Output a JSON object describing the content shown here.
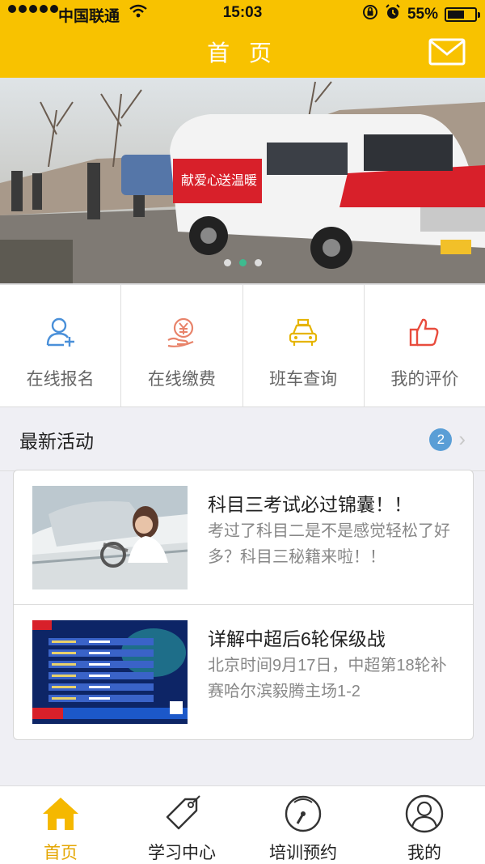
{
  "status": {
    "carrier": "中国联通",
    "time": "15:03",
    "battery": "55%"
  },
  "nav": {
    "title": "首 页"
  },
  "banner": {
    "van_text_1": "献爱心",
    "van_text_2": "送温暖",
    "active_dot": 1,
    "dot_count": 3
  },
  "quick_actions": [
    {
      "label": "在线报名",
      "icon": "user-add-icon",
      "color": "#4a90d9"
    },
    {
      "label": "在线缴费",
      "icon": "yuan-coin-icon",
      "color": "#e8836a"
    },
    {
      "label": "班车查询",
      "icon": "taxi-icon",
      "color": "#e6b400"
    },
    {
      "label": "我的评价",
      "icon": "thumbs-up-icon",
      "color": "#e84c3d"
    }
  ],
  "section": {
    "title": "最新活动",
    "badge": "2"
  },
  "news": [
    {
      "title": "科目三考试必过锦囊！！",
      "desc": "考过了科目二是不是感觉轻松了好多？科目三秘籍来啦！！"
    },
    {
      "title": "详解中超后6轮保级战",
      "desc": "北京时间9月17日，中超第18轮补赛哈尔滨毅腾主场1-2"
    }
  ],
  "tabs": [
    {
      "label": "首页",
      "icon": "home-icon",
      "active": true
    },
    {
      "label": "学习中心",
      "icon": "tag-icon",
      "active": false
    },
    {
      "label": "培训预约",
      "icon": "gauge-icon",
      "active": false
    },
    {
      "label": "我的",
      "icon": "person-icon",
      "active": false
    }
  ],
  "colors": {
    "brand": "#f8c200",
    "active_tab": "#e4a600",
    "badge": "#5a9ed6",
    "dot_active": "#3dbb8f"
  }
}
